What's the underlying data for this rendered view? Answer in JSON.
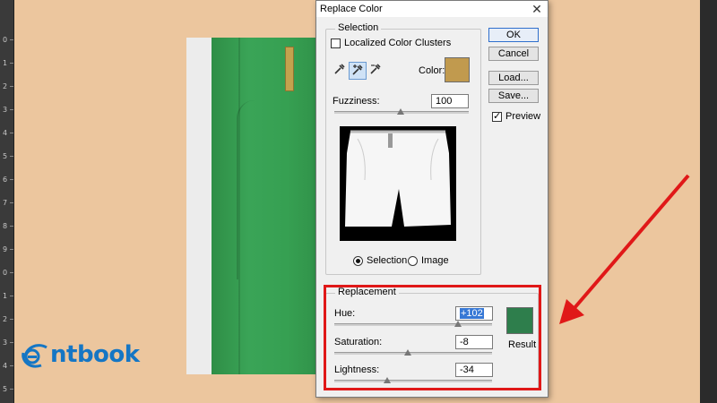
{
  "ruler": {
    "ticks": [
      "0",
      "1",
      "2",
      "3",
      "4",
      "5",
      "6",
      "7",
      "8",
      "9",
      "0",
      "1",
      "2",
      "3",
      "4",
      "5"
    ]
  },
  "brand": {
    "name": "ntbook"
  },
  "dialog": {
    "title": "Replace Color",
    "close_icon": "✕",
    "selection": {
      "legend": "Selection",
      "localized_label": "Localized Color Clusters",
      "localized_checked": false,
      "color_label": "Color:",
      "color_swatch": "#c19a4e",
      "fuzziness_label": "Fuzziness:",
      "fuzziness_value": "100",
      "radio_selection": "Selection",
      "radio_image": "Image",
      "selected_mode": "Selection"
    },
    "replacement": {
      "legend": "Replacement",
      "hue_label": "Hue:",
      "hue_value": "+102",
      "saturation_label": "Saturation:",
      "saturation_value": "-8",
      "lightness_label": "Lightness:",
      "lightness_value": "-34",
      "result_label": "Result",
      "result_swatch": "#2e7e4c"
    },
    "buttons": {
      "ok": "OK",
      "cancel": "Cancel",
      "load": "Load...",
      "save": "Save..."
    },
    "preview_label": "Preview",
    "preview_checked": true
  },
  "colors": {
    "canvas_bg": "#ecc69e",
    "highlight": "#e01818",
    "brand_blue": "#1576c4"
  }
}
